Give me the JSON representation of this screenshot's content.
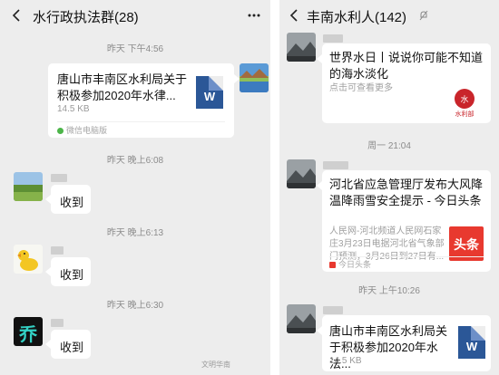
{
  "left": {
    "title": "水行政执法群(28)",
    "messages": [
      {
        "time": "昨天 下午4:56"
      },
      {
        "file_title": "唐山市丰南区水利局关于积极参加2020年水律...",
        "file_size": "14.5 KB",
        "file_source": "微信电脑版",
        "file_icon_letter": "W"
      },
      {
        "time": "昨天 晚上6:08"
      },
      {
        "text": "收到"
      },
      {
        "time": "昨天 晚上6:13"
      },
      {
        "text": "收到"
      },
      {
        "time": "昨天 晚上6:30"
      },
      {
        "text": "收到",
        "avatar_text": "乔"
      }
    ],
    "watermark": "文明华南"
  },
  "right": {
    "title": "丰南水利人(142)",
    "messages": [
      {
        "article_title": "世界水日丨说说你可能不知道的海水淡化",
        "article_desc": "点击可查看更多",
        "thumb_text": "水利部"
      },
      {
        "time": "周一 21:04"
      },
      {
        "article_title": "河北省应急管理厅发布大风降温降雨雪安全提示 - 今日头条",
        "article_desc": "人民网-河北频道人民网石家庄3月23日电据河北省气象部门预测，3月26日到27日有...",
        "thumb_text": "头条",
        "source": "今日头条"
      },
      {
        "time": "昨天 上午10:26"
      },
      {
        "file_title": "唐山市丰南区水利局关于积极参加2020年水法...",
        "file_size": "14.5 KB",
        "file_icon_letter": "W"
      }
    ]
  },
  "colors": {
    "chat_bg": "#ededed",
    "word_blue": "#2b5797",
    "toutiao_red": "#e8392f",
    "wechat_green": "#4cb549"
  }
}
